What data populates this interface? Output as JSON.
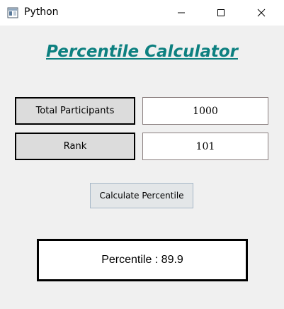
{
  "window": {
    "title": "Python",
    "icon": "python-app-icon"
  },
  "heading": "Percentile Calculator",
  "fields": {
    "total_participants_label": "Total Participants",
    "total_participants_value": "1000",
    "rank_label": "Rank",
    "rank_value": "101"
  },
  "calculate_button_label": "Calculate Percentile",
  "result_text": "Percentile : 89.9",
  "colors": {
    "heading": "#0d8080",
    "label_bg": "#dcdcdc",
    "button_bg": "#e3e6e8",
    "window_bg": "#f0f0f0"
  }
}
